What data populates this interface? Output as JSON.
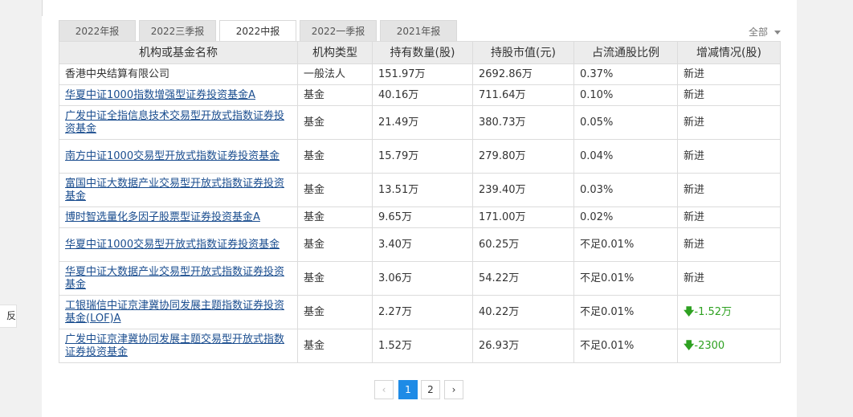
{
  "feedback_label": "反馈",
  "tabs": [
    {
      "label": "2022年报"
    },
    {
      "label": "2022三季报"
    },
    {
      "label": "2022中报"
    },
    {
      "label": "2022一季报"
    },
    {
      "label": "2021年报"
    }
  ],
  "active_tab": 2,
  "filter_label": "全部",
  "columns": [
    "机构或基金名称",
    "机构类型",
    "持有数量(股)",
    "持股市值(元)",
    "占流通股比例",
    "增减情况(股)"
  ],
  "rows": [
    {
      "name": "香港中央结算有限公司",
      "type": "一般法人",
      "shares": "151.97万",
      "value": "2692.86万",
      "ratio": "0.37%",
      "change": "新进",
      "link": false,
      "tall": false,
      "down": false
    },
    {
      "name": "华夏中证1000指数增强型证券投资基金A",
      "type": "基金",
      "shares": "40.16万",
      "value": "711.64万",
      "ratio": "0.10%",
      "change": "新进",
      "link": true,
      "tall": false,
      "down": false
    },
    {
      "name": "广发中证全指信息技术交易型开放式指数证券投资基金",
      "type": "基金",
      "shares": "21.49万",
      "value": "380.73万",
      "ratio": "0.05%",
      "change": "新进",
      "link": true,
      "tall": true,
      "down": false
    },
    {
      "name": "南方中证1000交易型开放式指数证券投资基金",
      "type": "基金",
      "shares": "15.79万",
      "value": "279.80万",
      "ratio": "0.04%",
      "change": "新进",
      "link": true,
      "tall": true,
      "down": false
    },
    {
      "name": "富国中证大数据产业交易型开放式指数证券投资基金",
      "type": "基金",
      "shares": "13.51万",
      "value": "239.40万",
      "ratio": "0.03%",
      "change": "新进",
      "link": true,
      "tall": true,
      "down": false
    },
    {
      "name": "博时智选量化多因子股票型证券投资基金A",
      "type": "基金",
      "shares": "9.65万",
      "value": "171.00万",
      "ratio": "0.02%",
      "change": "新进",
      "link": true,
      "tall": false,
      "down": false
    },
    {
      "name": "华夏中证1000交易型开放式指数证券投资基金",
      "type": "基金",
      "shares": "3.40万",
      "value": "60.25万",
      "ratio": "不足0.01%",
      "change": "新进",
      "link": true,
      "tall": true,
      "down": false
    },
    {
      "name": "华夏中证大数据产业交易型开放式指数证券投资基金",
      "type": "基金",
      "shares": "3.06万",
      "value": "54.22万",
      "ratio": "不足0.01%",
      "change": "新进",
      "link": true,
      "tall": true,
      "down": false
    },
    {
      "name": "工银瑞信中证京津冀协同发展主题指数证券投资基金(LOF)A",
      "type": "基金",
      "shares": "2.27万",
      "value": "40.22万",
      "ratio": "不足0.01%",
      "change": "-1.52万",
      "link": true,
      "tall": true,
      "down": true
    },
    {
      "name": "广发中证京津冀协同发展主题交易型开放式指数证券投资基金",
      "type": "基金",
      "shares": "1.52万",
      "value": "26.93万",
      "ratio": "不足0.01%",
      "change": "-2300",
      "link": true,
      "tall": true,
      "down": true
    }
  ],
  "pagination": {
    "prev": "‹",
    "pages": [
      "1",
      "2"
    ],
    "current": "1",
    "next": "›"
  },
  "colors": {
    "link": "#1a4d8f",
    "decrease": "#2ea121",
    "active_page": "#1e8be6"
  }
}
